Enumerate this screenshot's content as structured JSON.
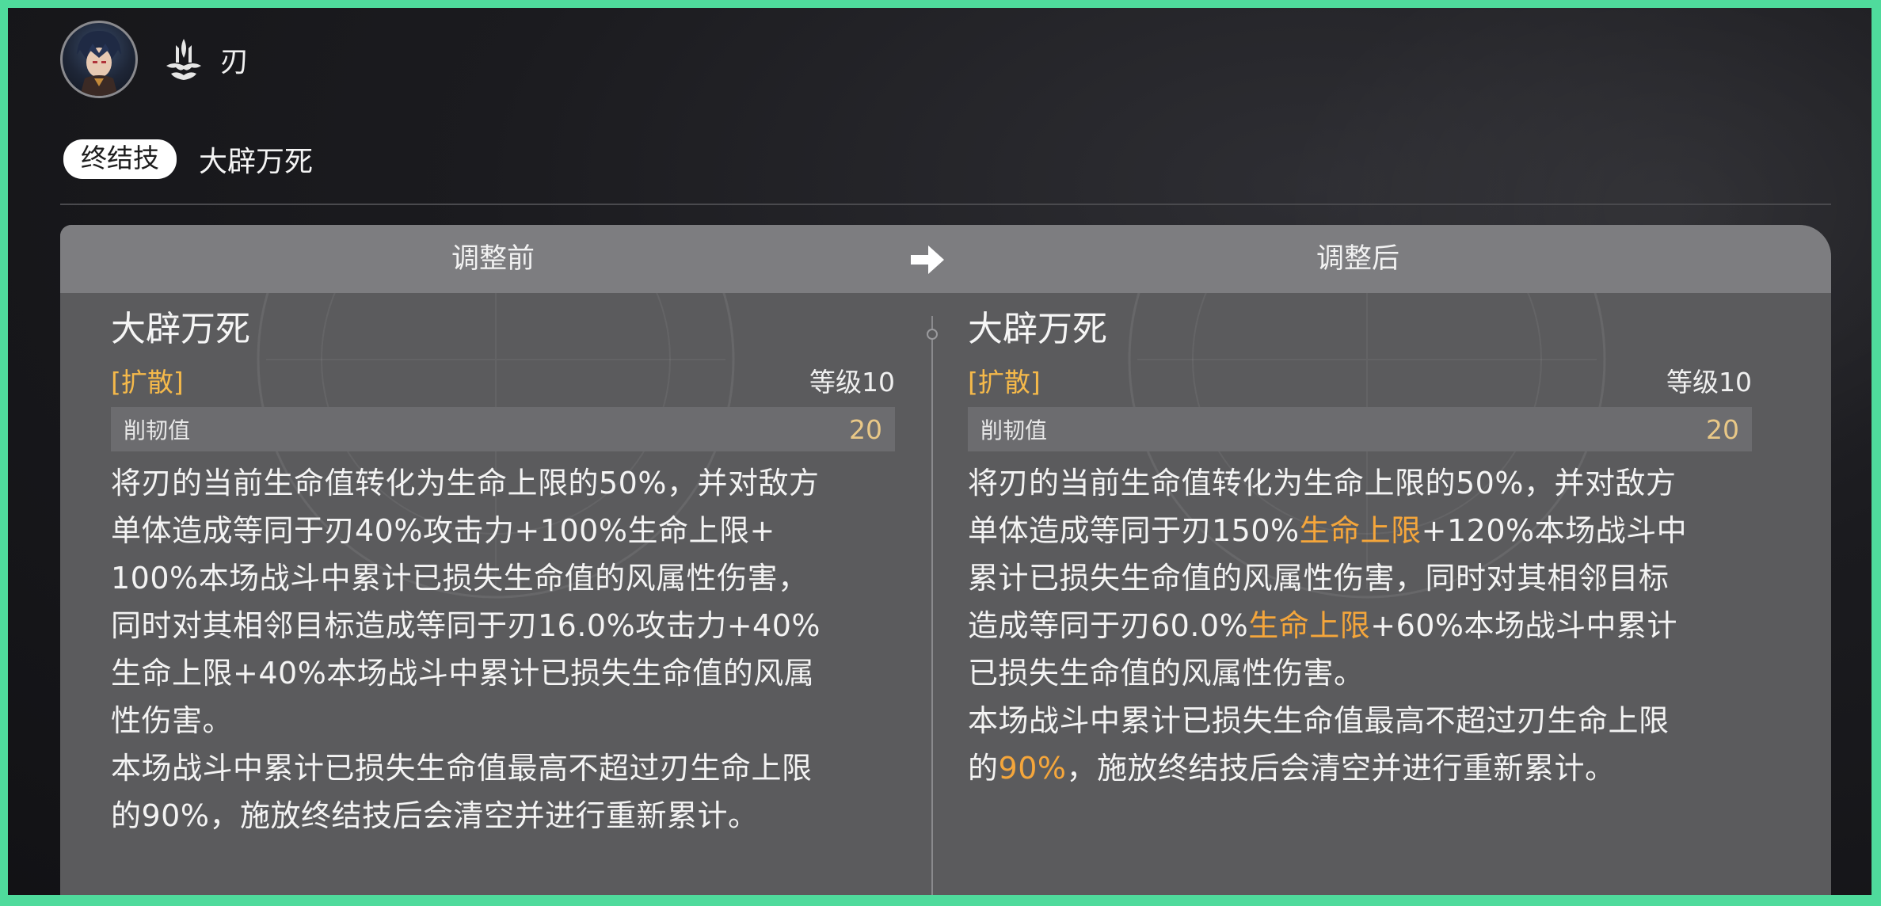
{
  "character": {
    "name": "刃",
    "avatar_icon": "character-portrait",
    "path_icon": "abundance-path-icon"
  },
  "skill": {
    "type_label": "终结技",
    "name": "大辟万死"
  },
  "comparison": {
    "before_label": "调整前",
    "after_label": "调整后",
    "arrow_icon": "arrow-right-icon"
  },
  "before": {
    "title": "大辟万死",
    "tag": "[扩散]",
    "level": "等级10",
    "stat_label": "削韧值",
    "stat_value": "20",
    "lines": [
      "将刃的当前生命值转化为生命上限的50%，并对敌方",
      "单体造成等同于刃40%攻击力+100%生命上限+",
      "100%本场战斗中累计已损失生命值的风属性伤害，",
      "同时对其相邻目标造成等同于刃16.0%攻击力+40%",
      "生命上限+40%本场战斗中累计已损失生命值的风属",
      "性伤害。",
      "本场战斗中累计已损失生命值最高不超过刃生命上限",
      "的90%，施放终结技后会清空并进行重新累计。"
    ]
  },
  "after": {
    "title": "大辟万死",
    "tag": "[扩散]",
    "level": "等级10",
    "stat_label": "削韧值",
    "stat_value": "20",
    "line1": "将刃的当前生命值转化为生命上限的50%，并对敌方",
    "line2_a": "单体造成等同于刃150%",
    "line2_hl": "生命上限",
    "line2_b": "+120%本场战斗中",
    "line3": "累计已损失生命值的风属性伤害，同时对其相邻目标",
    "line4_a": "造成等同于刃60.0%",
    "line4_hl": "生命上限",
    "line4_b": "+60%本场战斗中累计",
    "line5": "已损失生命值的风属性伤害。",
    "line6": "本场战斗中累计已损失生命值最高不超过刃生命上限",
    "line7_a": "的",
    "line7_hl": "90%",
    "line7_b": "，施放终结技后会清空并进行重新累计。"
  },
  "colors": {
    "frame": "#4fdb9c",
    "highlight": "#f5a63b",
    "tag": "#f5b94a"
  }
}
